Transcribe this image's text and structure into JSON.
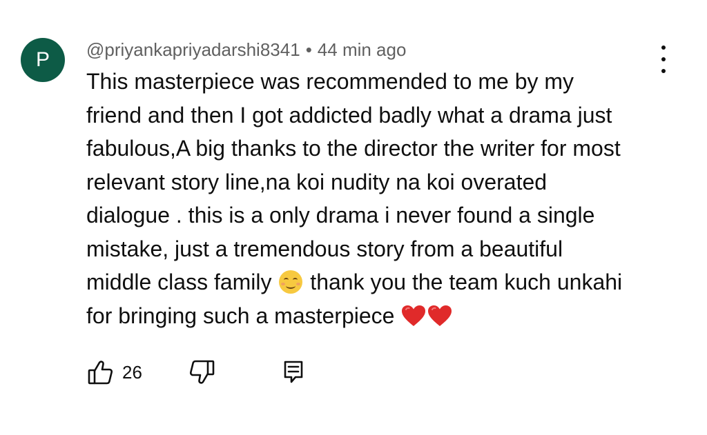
{
  "comment": {
    "avatar_letter": "P",
    "avatar_color": "#0d5b46",
    "author": "@priyankapriyadarshi8341",
    "separator": "•",
    "time": "44 min ago",
    "text_lines": [
      "This masterpiece was recommended to me by my",
      "friend and then I got addicted badly what a drama just",
      "fabulous,A big thanks to the director the writer for most",
      "relevant story line,na koi nudity na koi overated",
      "dialogue . this is a only drama i never found a single",
      "mistake, just a tremendous story from a beautiful",
      "middle class family",
      "thank you the team kuch unkahi",
      "for bringing such a masterpiece"
    ],
    "inline_emojis": [
      "smiling-face-emoji",
      "red-heart-emoji",
      "red-heart-emoji"
    ],
    "like_count": "26"
  },
  "icons": {
    "more": "more-vertical-icon",
    "like": "thumbs-up-icon",
    "dislike": "thumbs-down-icon",
    "reply": "reply-comment-icon"
  },
  "colors": {
    "text": "#0f0f0f",
    "meta": "#606060",
    "heart": "#e02a2a",
    "smile": "#f7c940"
  }
}
